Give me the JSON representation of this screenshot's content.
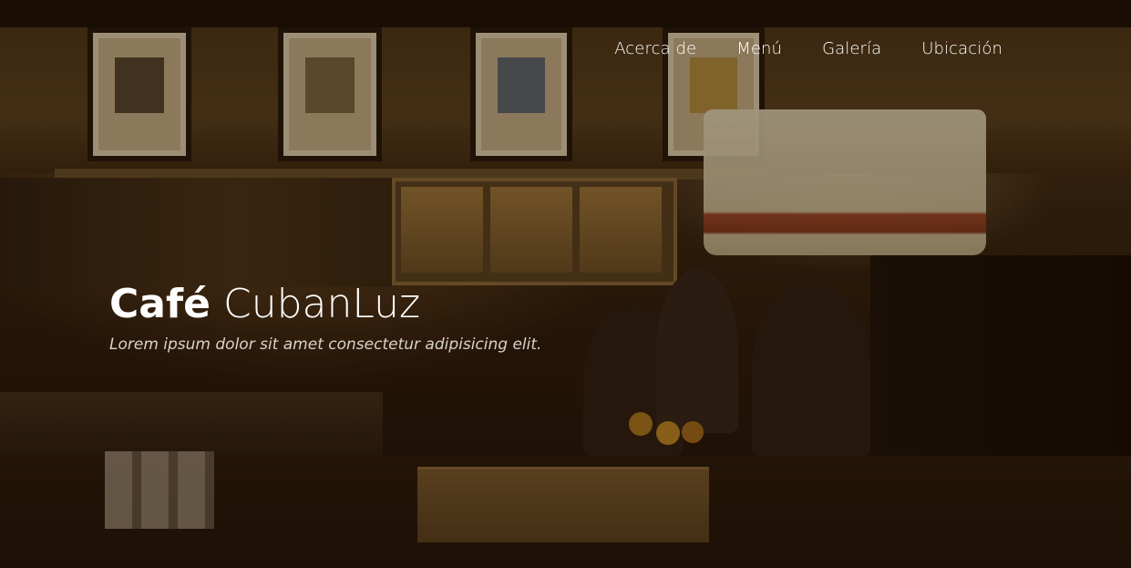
{
  "nav": {
    "items": [
      {
        "label": "Acerca de"
      },
      {
        "label": "Menú"
      },
      {
        "label": "Galería"
      },
      {
        "label": "Ubicación"
      }
    ]
  },
  "hero": {
    "title_bold": "Café",
    "title_light": "CubanLuz",
    "subtitle": "Lorem ipsum dolor sit amet consectetur adipisicing elit."
  },
  "colors": {
    "text": "#ffffff",
    "subtitle_text": "#d9d2c8",
    "overlay": "#190c02"
  },
  "background": {
    "icon": "cafe-interior-photo"
  }
}
